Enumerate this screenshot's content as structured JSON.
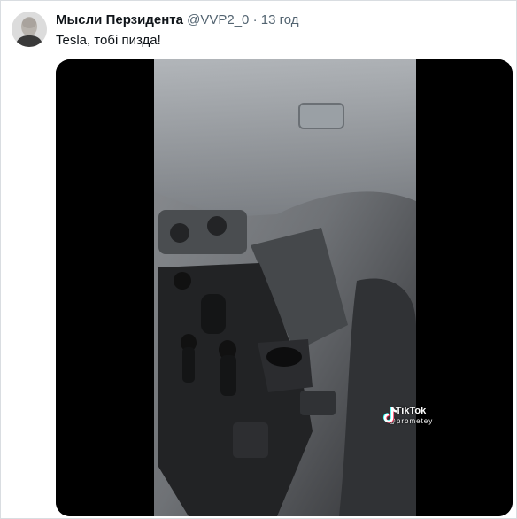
{
  "tweet": {
    "author_name": "Мысли Перзидента",
    "handle": "@VVP2_0",
    "separator": "·",
    "time": "13 год",
    "text": "Tesla, тобі пизда!"
  },
  "video": {
    "watermark_brand": "TikTok",
    "watermark_user": "@prometey"
  },
  "icons": {
    "avatar": "avatar-portrait",
    "watermark": "tiktok-icon"
  }
}
